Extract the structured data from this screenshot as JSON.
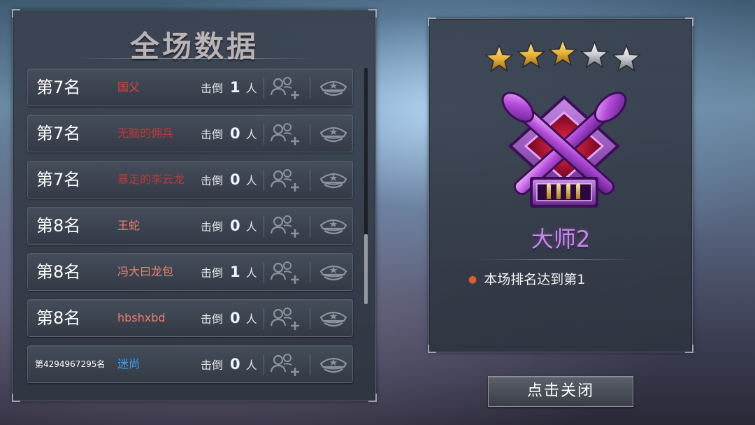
{
  "scoreboard": {
    "title": "全场数据",
    "kill_label": "击倒",
    "kill_unit": "人",
    "rows": [
      {
        "rank": "第7名",
        "name": "国父",
        "kills": "1"
      },
      {
        "rank": "第7名",
        "name": "无脑的佣兵",
        "kills": "0"
      },
      {
        "rank": "第7名",
        "name": "暴走的李云龙",
        "kills": "0"
      },
      {
        "rank": "第8名",
        "name": "王蛇",
        "kills": "0"
      },
      {
        "rank": "第8名",
        "name": "冯大曰龙包",
        "kills": "1"
      },
      {
        "rank": "第8名",
        "name": "hbshxbd",
        "kills": "0"
      },
      {
        "rank": "第4294967295名",
        "name": "迷尚",
        "kills": "0"
      }
    ]
  },
  "result": {
    "stars_filled": 3,
    "stars_total": 5,
    "rank_title": "大师2",
    "achievement": "本场排名达到第1"
  },
  "close_button": "点击关闭",
  "colors": {
    "name_red": "#e0403d",
    "name_salmon": "#f07e6e",
    "name_blue": "#3ba0ef",
    "rank_purple": "#c48ae8",
    "bullet_orange": "#e0602e",
    "star_gold": "#e8b53a",
    "star_silver": "#c9ccd2"
  },
  "icons": {
    "add_friend": "add-friend-icon",
    "profile": "military-cap-icon",
    "badge": "crossed-rockets-badge-icon"
  }
}
